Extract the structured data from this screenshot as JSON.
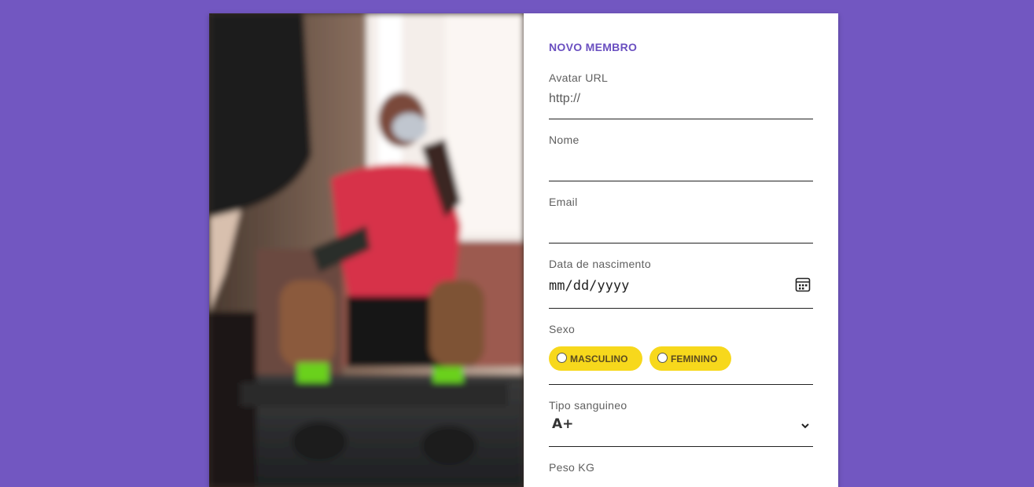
{
  "form": {
    "title": "NOVO MEMBRO",
    "avatar_url": {
      "label": "Avatar URL",
      "value": "http://"
    },
    "nome": {
      "label": "Nome",
      "value": ""
    },
    "email": {
      "label": "Email",
      "value": ""
    },
    "data_nascimento": {
      "label": "Data de nascimento",
      "placeholder": "mm/dd/yyyy",
      "icon": "calendar-icon"
    },
    "sexo": {
      "label": "Sexo",
      "options": [
        "MASCULINO",
        "FEMININO"
      ],
      "pill_color": "#f7d81c"
    },
    "tipo_sanguineo": {
      "label": "Tipo sanguineo",
      "selected": "A+",
      "icon": "chevron-down-icon"
    },
    "peso": {
      "label": "Peso KG"
    }
  },
  "colors": {
    "background": "#7257c1",
    "accent": "#6a4fc0",
    "card": "#ffffff"
  }
}
